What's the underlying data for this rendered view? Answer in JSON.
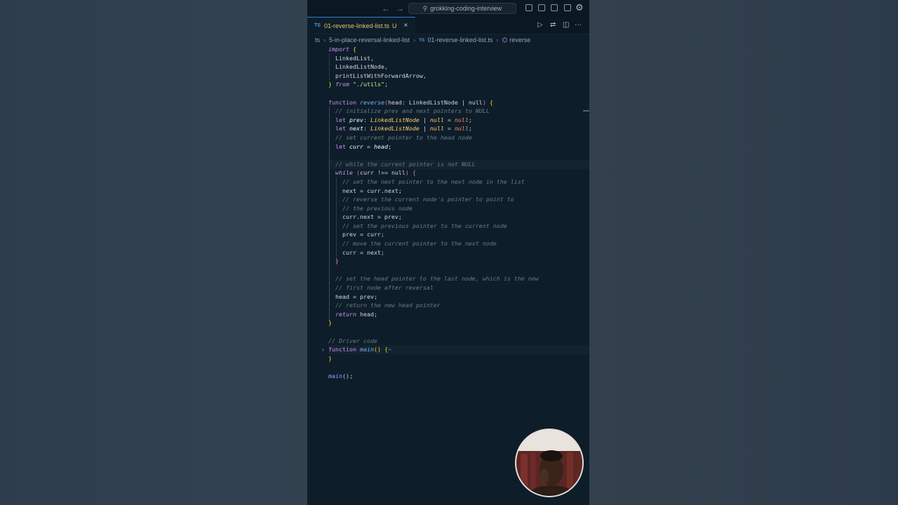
{
  "titlebar": {
    "back_icon": "arrow-left-icon",
    "forward_icon": "arrow-right-icon",
    "search_text": "grokking-coding-interview",
    "layout_icons": [
      "toggle-primary-sidebar-icon",
      "toggle-panel-icon",
      "toggle-secondary-sidebar-icon",
      "customize-layout-icon",
      "settings-gear-icon"
    ]
  },
  "tab": {
    "lang_badge": "TS",
    "name": "01-reverse-linked-list.ts",
    "status": "U",
    "close": "×"
  },
  "tab_actions": {
    "run": "▷",
    "compare": "⇄",
    "split": "◫",
    "more": "···"
  },
  "breadcrumb": {
    "root": "ts",
    "folder": "5-in-place-reversal-linked-list",
    "file_badge": "TS",
    "file": "01-reverse-linked-list.ts",
    "symbol_icon": "⌬",
    "symbol": "reverse",
    "separator": "›"
  },
  "code": {
    "l1_kw": "import",
    "l1_br": "{",
    "l2": "  LinkedList,",
    "l3": "  LinkedListNode,",
    "l4": "  printListWithForwardArrow,",
    "l5_br": "}",
    "l5_kw": "from",
    "l5_str": "\"./utils\"",
    "l5_end": ";",
    "l7_kw": "function",
    "l7_fn": "reverse",
    "l7_p1": "(",
    "l7_arg": "head: LinkedListNode | null",
    "l7_p2": ")",
    "l7_br": "{",
    "l8_cm": "// initialize prev and next pointers to NULL",
    "l9_kw": "let",
    "l9_var": "prev",
    "l9_colon": ": ",
    "l9_ty": "LinkedListNode",
    "l9_bar": " | ",
    "l9_null": "null",
    "l9_eq": " = ",
    "l9_null2": "null",
    "l9_end": ";",
    "l10_kw": "let",
    "l10_var": "next",
    "l10_colon": ": ",
    "l10_ty": "LinkedListNode",
    "l10_bar": " | ",
    "l10_null": "null",
    "l10_eq": " = ",
    "l10_null2": "null",
    "l10_end": ";",
    "l11_cm": "// set current pointer to the head node",
    "l12_kw": "let",
    "l12_var": "curr",
    "l12_eq": " = ",
    "l12_val": "head",
    "l12_end": ";",
    "l14_cm": "// while the current pointer is not NULL",
    "l15_kw": "while",
    "l15_p1": "(",
    "l15_cond": "curr !== null",
    "l15_p2": ")",
    "l15_br": "{",
    "l16_cm": "// set the next pointer to the next node in the list",
    "l17": "next = curr.next;",
    "l18_cm": "// reverse the current node's pointer to point to",
    "l19_cm": "// the previous node",
    "l20": "curr.next = prev;",
    "l21_cm": "// set the previous pointer to the current node",
    "l22": "prev = curr;",
    "l23_cm": "// move the current pointer to the next node",
    "l24": "curr = next;",
    "l25_br": "}",
    "l27_cm": "// set the head pointer to the last node, which is the new",
    "l28_cm": "// first node after reversal",
    "l29": "head = prev;",
    "l30_cm": "// return the new head pointer",
    "l31_kw": "return",
    "l31_rest": " head;",
    "l32_br": "}",
    "l34_cm": "// Driver code",
    "l35_kw": "function",
    "l35_fn": "main",
    "l35_par": "()",
    "l35_br": "{",
    "l35_dots": "⋯",
    "l36_br": "}",
    "l38_fn": "main",
    "l38_rest": "();"
  },
  "fold_icon": "chevron-right-icon",
  "fold_glyph": "›",
  "webcam": "presenter-webcam-overlay"
}
